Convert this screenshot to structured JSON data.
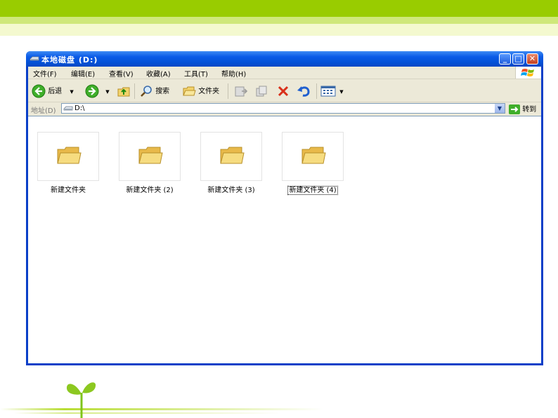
{
  "window": {
    "title": "本地磁盘 (D:)",
    "controls": {
      "minimize": "_",
      "maximize": "□",
      "close": "✕"
    }
  },
  "menu": [
    "文件(F)",
    "编辑(E)",
    "查看(V)",
    "收藏(A)",
    "工具(T)",
    "帮助(H)"
  ],
  "toolbar": {
    "back_label": "后退",
    "search_label": "搜索",
    "folders_label": "文件夹"
  },
  "address": {
    "label": "地址(D)",
    "value": "D:\\",
    "go_label": "转到"
  },
  "folders": [
    {
      "name": "新建文件夹",
      "selected": false
    },
    {
      "name": "新建文件夹 (2)",
      "selected": false
    },
    {
      "name": "新建文件夹 (3)",
      "selected": false
    },
    {
      "name": "新建文件夹 (4)",
      "selected": true
    }
  ],
  "colors": {
    "slide_band": "#99cc00",
    "titlebar_blue": "#0452d8",
    "window_face": "#ece9d8",
    "folder_yellow": "#f3d36b"
  }
}
